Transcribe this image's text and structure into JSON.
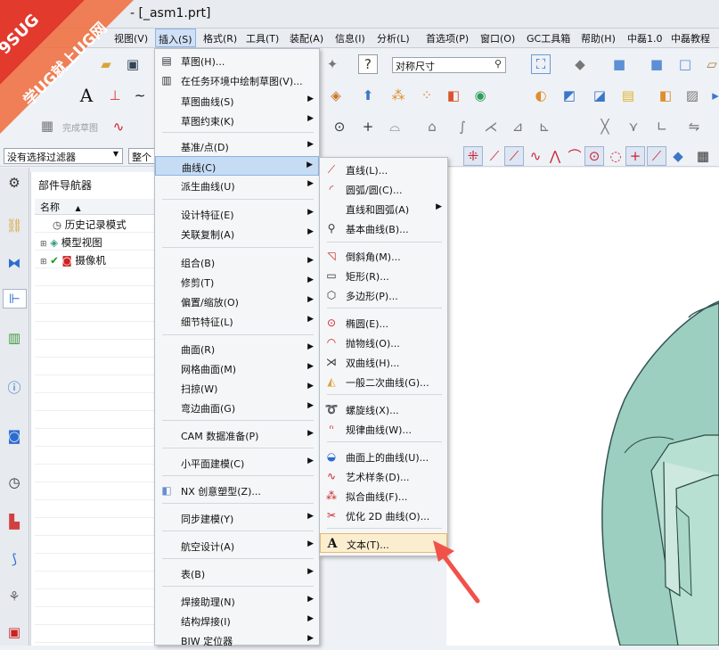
{
  "window": {
    "title": "- [_asm1.prt]"
  },
  "watermark": {
    "line1": "9SUG",
    "line2": "学UG就上UG网"
  },
  "menubar": [
    "视图(V)",
    "插入(S)",
    "格式(R)",
    "工具(T)",
    "装配(A)",
    "信息(I)",
    "分析(L)",
    "首选项(P)",
    "窗口(O)",
    "GC工具箱",
    "帮助(H)",
    "中磊1.0",
    "中磊教程"
  ],
  "toolbar": {
    "dimension_combo": "对称尺寸",
    "finish_sketch": "完成草图"
  },
  "filterbar": {
    "filter": "没有选择过滤器",
    "scope": "整个"
  },
  "navigator": {
    "title": "部件导航器",
    "column": "名称",
    "rows": [
      "历史记录模式",
      "模型视图",
      "摄像机"
    ]
  },
  "insert_menu": {
    "items": [
      {
        "label": "草图(H)...",
        "icon": "sketch-icon",
        "arrow": false
      },
      {
        "label": "在任务环境中绘制草图(V)...",
        "icon": "sketch-task-icon",
        "arrow": false
      },
      {
        "label": "草图曲线(S)",
        "icon": "",
        "arrow": true
      },
      {
        "label": "草图约束(K)",
        "icon": "",
        "arrow": true
      },
      {
        "label": "基准/点(D)",
        "icon": "",
        "arrow": true
      },
      {
        "label": "曲线(C)",
        "icon": "",
        "arrow": true,
        "highlight": true
      },
      {
        "label": "派生曲线(U)",
        "icon": "",
        "arrow": true
      },
      {
        "label": "设计特征(E)",
        "icon": "",
        "arrow": true
      },
      {
        "label": "关联复制(A)",
        "icon": "",
        "arrow": true
      },
      {
        "label": "组合(B)",
        "icon": "",
        "arrow": true
      },
      {
        "label": "修剪(T)",
        "icon": "",
        "arrow": true
      },
      {
        "label": "偏置/缩放(O)",
        "icon": "",
        "arrow": true
      },
      {
        "label": "细节特征(L)",
        "icon": "",
        "arrow": true
      },
      {
        "label": "曲面(R)",
        "icon": "",
        "arrow": true
      },
      {
        "label": "网格曲面(M)",
        "icon": "",
        "arrow": true
      },
      {
        "label": "扫掠(W)",
        "icon": "",
        "arrow": true
      },
      {
        "label": "弯边曲面(G)",
        "icon": "",
        "arrow": true
      },
      {
        "label": "CAM 数据准备(P)",
        "icon": "",
        "arrow": true
      },
      {
        "label": "小平面建模(C)",
        "icon": "",
        "arrow": true
      },
      {
        "label": "NX 创意塑型(Z)...",
        "icon": "cube-icon",
        "arrow": false
      },
      {
        "label": "同步建模(Y)",
        "icon": "",
        "arrow": true
      },
      {
        "label": "航空设计(A)",
        "icon": "",
        "arrow": true
      },
      {
        "label": "表(B)",
        "icon": "",
        "arrow": true
      },
      {
        "label": "焊接助理(N)",
        "icon": "",
        "arrow": true
      },
      {
        "label": "结构焊接(I)",
        "icon": "",
        "arrow": true
      },
      {
        "label": "BIW 定位器",
        "icon": "",
        "arrow": true
      }
    ]
  },
  "curve_menu": {
    "items": [
      {
        "label": "直线(L)...",
        "icon": "line-icon",
        "arrow": false
      },
      {
        "label": "圆弧/圆(C)...",
        "icon": "arc-icon",
        "arrow": false
      },
      {
        "label": "直线和圆弧(A)",
        "icon": "",
        "arrow": true
      },
      {
        "label": "基本曲线(B)...",
        "icon": "basic-curve-icon",
        "arrow": false
      },
      {
        "label": "倒斜角(M)...",
        "icon": "chamfer-icon",
        "arrow": false
      },
      {
        "label": "矩形(R)...",
        "icon": "rectangle-icon",
        "arrow": false
      },
      {
        "label": "多边形(P)...",
        "icon": "polygon-icon",
        "arrow": false
      },
      {
        "label": "椭圆(E)...",
        "icon": "ellipse-icon",
        "arrow": false
      },
      {
        "label": "抛物线(O)...",
        "icon": "parabola-icon",
        "arrow": false
      },
      {
        "label": "双曲线(H)...",
        "icon": "hyperbola-icon",
        "arrow": false
      },
      {
        "label": "一般二次曲线(G)...",
        "icon": "conic-icon",
        "arrow": false
      },
      {
        "label": "螺旋线(X)...",
        "icon": "helix-icon",
        "arrow": false
      },
      {
        "label": "规律曲线(W)...",
        "icon": "law-curve-icon",
        "arrow": false
      },
      {
        "label": "曲面上的曲线(U)...",
        "icon": "curve-on-surface-icon",
        "arrow": false
      },
      {
        "label": "艺术样条(D)...",
        "icon": "spline-icon",
        "arrow": false
      },
      {
        "label": "拟合曲线(F)...",
        "icon": "fit-curve-icon",
        "arrow": false
      },
      {
        "label": "优化 2D 曲线(O)...",
        "icon": "optimize-2d-icon",
        "arrow": false
      },
      {
        "label": "文本(T)...",
        "icon": "text-icon",
        "arrow": false,
        "highlight": true
      }
    ]
  }
}
